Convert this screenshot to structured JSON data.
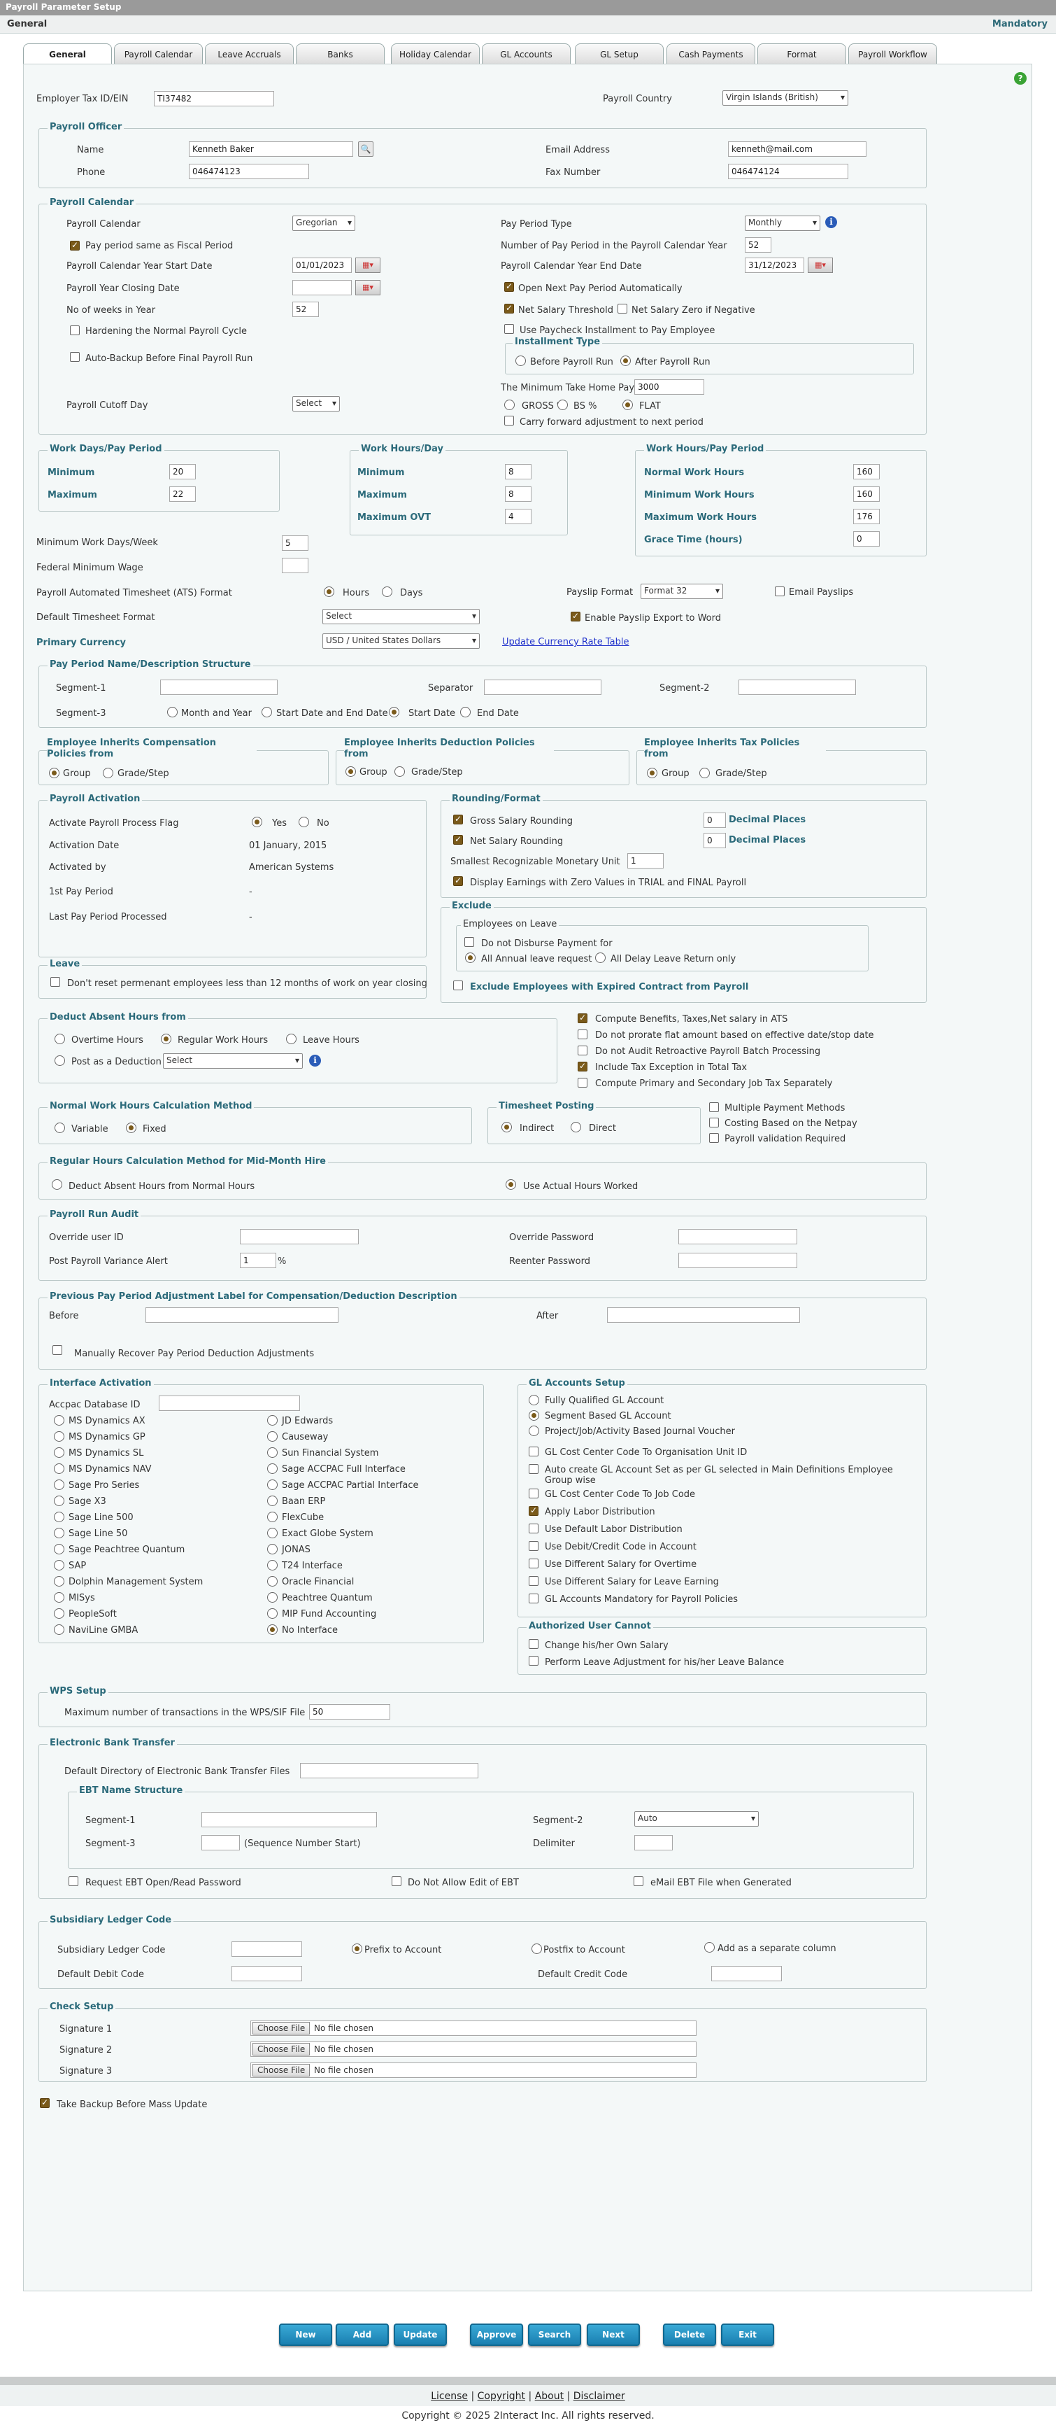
{
  "titlebar": {
    "title": "Payroll Parameter Setup"
  },
  "subbar": {
    "title": "General",
    "mandatory": "Mandatory"
  },
  "tabs": [
    "General",
    "Payroll Calendar",
    "Leave Accruals",
    "Banks",
    "Holiday Calendar",
    "GL Accounts",
    "GL Setup",
    "Cash Payments",
    "Format",
    "Payroll Workflow"
  ],
  "top": {
    "tax_label": "Employer Tax ID/EIN",
    "tax_value": "TI37482",
    "country_label": "Payroll Country",
    "country_value": "Virgin Islands (British)"
  },
  "officer": {
    "legend": "Payroll Officer",
    "name_label": "Name",
    "name_value": "Kenneth Baker",
    "email_label": "Email Address",
    "email_value": "kenneth@mail.com",
    "phone_label": "Phone",
    "phone_value": "046474123",
    "fax_label": "Fax Number",
    "fax_value": "046474124"
  },
  "calendar": {
    "legend": "Payroll Calendar",
    "cal_label": "Payroll Calendar",
    "cal_value": "Gregorian",
    "same_fiscal": "Pay period same as Fiscal Period",
    "start_label": "Payroll Calendar Year Start Date",
    "start_value": "01/01/2023",
    "closing_label": "Payroll Year Closing Date",
    "weeks_label": "No of weeks in Year",
    "weeks_value": "52",
    "hardening": "Hardening the Normal Payroll Cycle",
    "autobackup": "Auto-Backup Before Final Payroll Run",
    "cutoff_label": "Payroll Cutoff Day",
    "cutoff_value": "Select",
    "ptype_label": "Pay Period Type",
    "ptype_value": "Monthly",
    "num_label": "Number of Pay Period in the Payroll Calendar Year",
    "num_value": "52",
    "end_label": "Payroll Calendar Year End Date",
    "end_value": "31/12/2023",
    "open_next": "Open Next Pay Period Automatically",
    "net_threshold": "Net Salary Threshold",
    "net_zero": "Net Salary Zero if Negative",
    "use_paycheck": "Use Paycheck Installment to Pay Employee",
    "inst_legend": "Installment Type",
    "inst_before": "Before Payroll Run",
    "inst_after": "After Payroll Run",
    "min_label": "The Minimum Take Home Pay",
    "min_value": "3000",
    "gross": "GROSS %",
    "bs": "BS %",
    "flat": "FLAT",
    "carry": "Carry forward adjustment to next period"
  },
  "workdays": {
    "legend": "Work Days/Pay Period",
    "min_label": "Minimum",
    "min_value": "20",
    "max_label": "Maximum",
    "max_value": "22"
  },
  "workhours": {
    "legend": "Work Hours/Day",
    "min_label": "Minimum",
    "min_value": "8",
    "max_label": "Maximum",
    "max_value": "8",
    "ovt_label": "Maximum OVT",
    "ovt_value": "4"
  },
  "workhoursperiod": {
    "legend": "Work Hours/Pay Period",
    "normal_label": "Normal Work Hours",
    "normal_value": "160",
    "min_label": "Minimum Work Hours",
    "min_value": "160",
    "max_label": "Maximum Work Hours",
    "max_value": "176",
    "grace_label": "Grace Time (hours)",
    "grace_value": "0"
  },
  "misc": {
    "minweek_label": "Minimum Work Days/Week",
    "minweek_value": "5",
    "fedmin_label": "Federal Minimum Wage",
    "ats_label": "Payroll Automated Timesheet (ATS) Format",
    "hours": "Hours",
    "days": "Days",
    "payslip_label": "Payslip Format",
    "payslip_value": "Format 32",
    "email_payslips": "Email Payslips",
    "ts_label": "Default Timesheet Format",
    "ts_value": "Select",
    "enable_export": "Enable Payslip Export to Word",
    "currency_label": "Primary Currency",
    "currency_value": "USD / United States Dollars",
    "update_rate": "Update Currency Rate Table"
  },
  "ppname": {
    "legend": "Pay Period Name/Description Structure",
    "seg1": "Segment-1",
    "sep": "Separator",
    "seg2": "Segment-2",
    "seg3": "Segment-3",
    "month_year": "Month and Year",
    "start_end": "Start Date and End Date",
    "start_date": "Start Date",
    "end_date": "End Date"
  },
  "inherit": {
    "comp_legend": "Employee Inherits Compensation Policies from",
    "ded_legend": "Employee Inherits Deduction Policies from",
    "tax_legend": "Employee Inherits Tax Policies from",
    "group": "Group",
    "grade": "Grade/Step"
  },
  "activation": {
    "legend": "Payroll Activation",
    "flag_label": "Activate Payroll Process Flag",
    "yes": "Yes",
    "no": "No",
    "date_label": "Activation Date",
    "date_value": "01 January, 2015",
    "by_label": "Activated by",
    "by_value": "American Systems",
    "first_label": "1st Pay Period",
    "first_value": "-",
    "last_label": "Last Pay Period Processed",
    "last_value": "-"
  },
  "rounding": {
    "legend": "Rounding/Format",
    "gross": "Gross Salary Rounding",
    "gross_value": "0",
    "net": "Net Salary Rounding",
    "net_value": "0",
    "decimal": "Decimal Places",
    "smallest_label": "Smallest Recognizable Monetary Unit",
    "smallest_value": "1",
    "display_zero": "Display Earnings with Zero Values in TRIAL and FINAL Payroll"
  },
  "exclude": {
    "legend": "Exclude",
    "emp_legend": "Employees on Leave",
    "not_disburse": "Do not Disburse Payment for",
    "all_annual": "All Annual leave request",
    "all_delay": "All Delay Leave Return only",
    "expired": "Exclude Employees with Expired Contract from Payroll"
  },
  "leave": {
    "legend": "Leave",
    "dont_reset": "Don't reset permenant employees less than 12 months of work on year closing"
  },
  "deduct": {
    "legend": "Deduct Absent Hours from",
    "overtime": "Overtime Hours",
    "regular": "Regular Work Hours",
    "leave": "Leave Hours",
    "post": "Post as a Deduction",
    "select": "Select"
  },
  "computeopts": [
    "Compute Benefits, Taxes,Net salary in ATS",
    "Do not prorate flat amount based on effective date/stop date",
    "Do not Audit Retroactive Payroll Batch Processing",
    "Include Tax Exception in Total Tax",
    "Compute Primary and Secondary Job Tax Separately"
  ],
  "normalcalc": {
    "legend": "Normal Work Hours Calculation Method",
    "variable": "Variable",
    "fixed": "Fixed"
  },
  "tsposting": {
    "legend": "Timesheet Posting",
    "indirect": "Indirect",
    "direct": "Direct"
  },
  "multiopts": [
    "Multiple Payment Methods",
    "Costing Based on the Netpay",
    "Payroll validation Required"
  ],
  "regcalc": {
    "legend": "Regular Hours Calculation Method for Mid-Month Hire",
    "deduct": "Deduct Absent Hours from Normal Hours",
    "actual": "Use Actual Hours Worked"
  },
  "audit": {
    "legend": "Payroll Run Audit",
    "override_user": "Override user ID",
    "override_pw": "Override Password",
    "variance": "Post Payroll Variance Alert",
    "variance_value": "1",
    "percent": "%",
    "reenter": "Reenter Password"
  },
  "prevadj": {
    "legend": "Previous Pay Period Adjustment Label for Compensation/Deduction Description",
    "before": "Before",
    "after": "After",
    "manual": "Manually Recover Pay Period Deduction Adjustments"
  },
  "interface": {
    "legend": "Interface Activation",
    "accpac": "Accpac Database ID",
    "col1": [
      "MS Dynamics AX",
      "MS Dynamics GP",
      "MS Dynamics SL",
      "MS Dynamics NAV",
      "Sage Pro Series",
      "Sage X3",
      "Sage Line 500",
      "Sage Line 50",
      "Sage Peachtree Quantum",
      "SAP",
      "Dolphin Management System",
      "MISys",
      "PeopleSoft",
      "NaviLine GMBA"
    ],
    "col2": [
      "JD Edwards",
      "Causeway",
      "Sun Financial System",
      "Sage ACCPAC Full Interface",
      "Sage ACCPAC Partial Interface",
      "Baan ERP",
      "FlexCube",
      "Exact Globe System",
      "JONAS",
      "T24 Interface",
      "Oracle Financial",
      "Peachtree Quantum",
      "MIP Fund Accounting",
      "No Interface"
    ]
  },
  "glsetup": {
    "legend": "GL Accounts Setup",
    "radios": [
      "Fully Qualified GL Account",
      "Segment Based GL Account",
      "Project/Job/Activity Based Journal Voucher"
    ],
    "checks": [
      "GL Cost Center Code To Organisation Unit ID",
      "Auto create GL Account Set as per GL selected in Main Definitions Employee Group wise",
      "GL Cost Center Code To Job Code",
      "Apply Labor Distribution",
      "Use Default Labor Distribution",
      "Use Debit/Credit Code in Account",
      "Use Different Salary for Overtime",
      "Use Different Salary for Leave Earning",
      "GL Accounts Mandatory for Payroll Policies"
    ]
  },
  "authuser": {
    "legend": "Authorized User Cannot",
    "change": "Change his/her Own Salary",
    "perform": "Perform Leave Adjustment for his/her Leave Balance"
  },
  "wps": {
    "legend": "WPS Setup",
    "max_label": "Maximum number of transactions in the WPS/SIF File",
    "max_value": "50"
  },
  "ebt": {
    "legend": "Electronic Bank Transfer",
    "dir_label": "Default Directory of Electronic Bank Transfer Files",
    "name_legend": "EBT Name Structure",
    "seg1": "Segment-1",
    "seg2": "Segment-2",
    "seg2_value": "Auto",
    "seg3": "Segment-3",
    "seqnote": "(Sequence Number Start)",
    "delim": "Delimiter",
    "req_open": "Request EBT Open/Read Password",
    "no_edit": "Do Not Allow Edit of EBT",
    "email_file": "eMail EBT File when Generated"
  },
  "subledger": {
    "legend": "Subsidiary Ledger Code",
    "code": "Subsidiary Ledger Code",
    "prefix": "Prefix to Account",
    "postfix": "Postfix to Account",
    "separate": "Add as a separate column",
    "debit": "Default Debit Code",
    "credit": "Default Credit Code"
  },
  "check": {
    "legend": "Check Setup",
    "sig1": "Signature 1",
    "sig2": "Signature 2",
    "sig3": "Signature 3",
    "choose": "Choose File",
    "nofile": "No file chosen"
  },
  "backup": "Take Backup Before Mass Update",
  "actions": [
    "New",
    "Add",
    "Update",
    "Approve",
    "Search",
    "Next",
    "Delete",
    "Exit"
  ],
  "footer": {
    "links": [
      "License",
      "Copyright",
      "About",
      "Disclaimer"
    ],
    "sep": "|",
    "copyright": "Copyright © 2025 2Interact Inc. All rights reserved."
  }
}
